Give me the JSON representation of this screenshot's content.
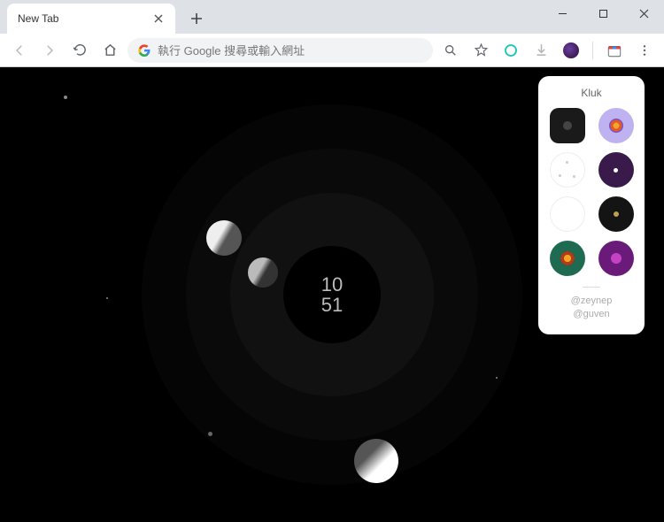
{
  "tab": {
    "title": "New Tab"
  },
  "omnibox": {
    "placeholder": "執行 Google 搜尋或輸入網址"
  },
  "clock": {
    "hours": "10",
    "minutes": "51"
  },
  "panel": {
    "title": "Kluk",
    "credit1": "@zeynep",
    "credit2": "@guven"
  }
}
